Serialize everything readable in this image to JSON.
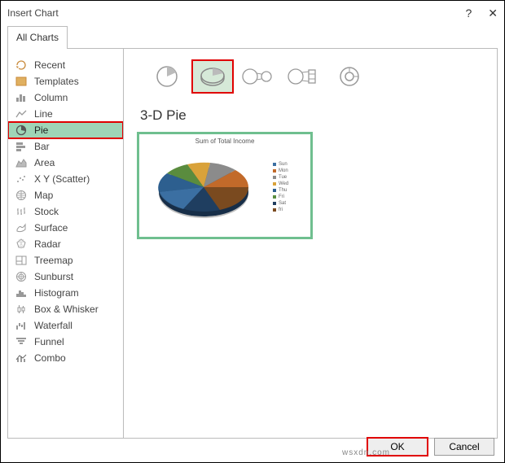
{
  "dialog": {
    "title": "Insert Chart"
  },
  "tabs": {
    "all": "All Charts"
  },
  "sidebar": {
    "items": [
      {
        "label": "Recent"
      },
      {
        "label": "Templates"
      },
      {
        "label": "Column"
      },
      {
        "label": "Line"
      },
      {
        "label": "Pie"
      },
      {
        "label": "Bar"
      },
      {
        "label": "Area"
      },
      {
        "label": "X Y (Scatter)"
      },
      {
        "label": "Map"
      },
      {
        "label": "Stock"
      },
      {
        "label": "Surface"
      },
      {
        "label": "Radar"
      },
      {
        "label": "Treemap"
      },
      {
        "label": "Sunburst"
      },
      {
        "label": "Histogram"
      },
      {
        "label": "Box & Whisker"
      },
      {
        "label": "Waterfall"
      },
      {
        "label": "Funnel"
      },
      {
        "label": "Combo"
      }
    ]
  },
  "main": {
    "section_heading": "3-D Pie",
    "preview_title": "Sum of Total Income",
    "legend": [
      "Sun",
      "Mon",
      "Tue",
      "Wed",
      "Thu",
      "Fri",
      "Sat",
      "fri"
    ]
  },
  "buttons": {
    "ok": "OK",
    "cancel": "Cancel"
  },
  "watermark": "wsxdn.com",
  "colors": {
    "active_row": "#9fd5b7",
    "highlight": "#e00000",
    "preview_border": "#6fbf8f",
    "pie": [
      "#3b6fa2",
      "#c26a2a",
      "#8b8b8b",
      "#d9a23a",
      "#2d5f8f",
      "#5a8c3e",
      "#1f3e60",
      "#7a4a1f"
    ]
  },
  "chart_data": {
    "type": "pie",
    "title": "Sum of Total Income",
    "categories": [
      "Sun",
      "Mon",
      "Tue",
      "Wed",
      "Thu",
      "Fri",
      "Sat",
      "fri"
    ],
    "values": [
      13,
      13,
      13,
      12,
      12,
      12,
      13,
      12
    ],
    "note": "3-D pie preview; slice sizes visually estimated as roughly equal; no explicit data labels in screenshot"
  }
}
